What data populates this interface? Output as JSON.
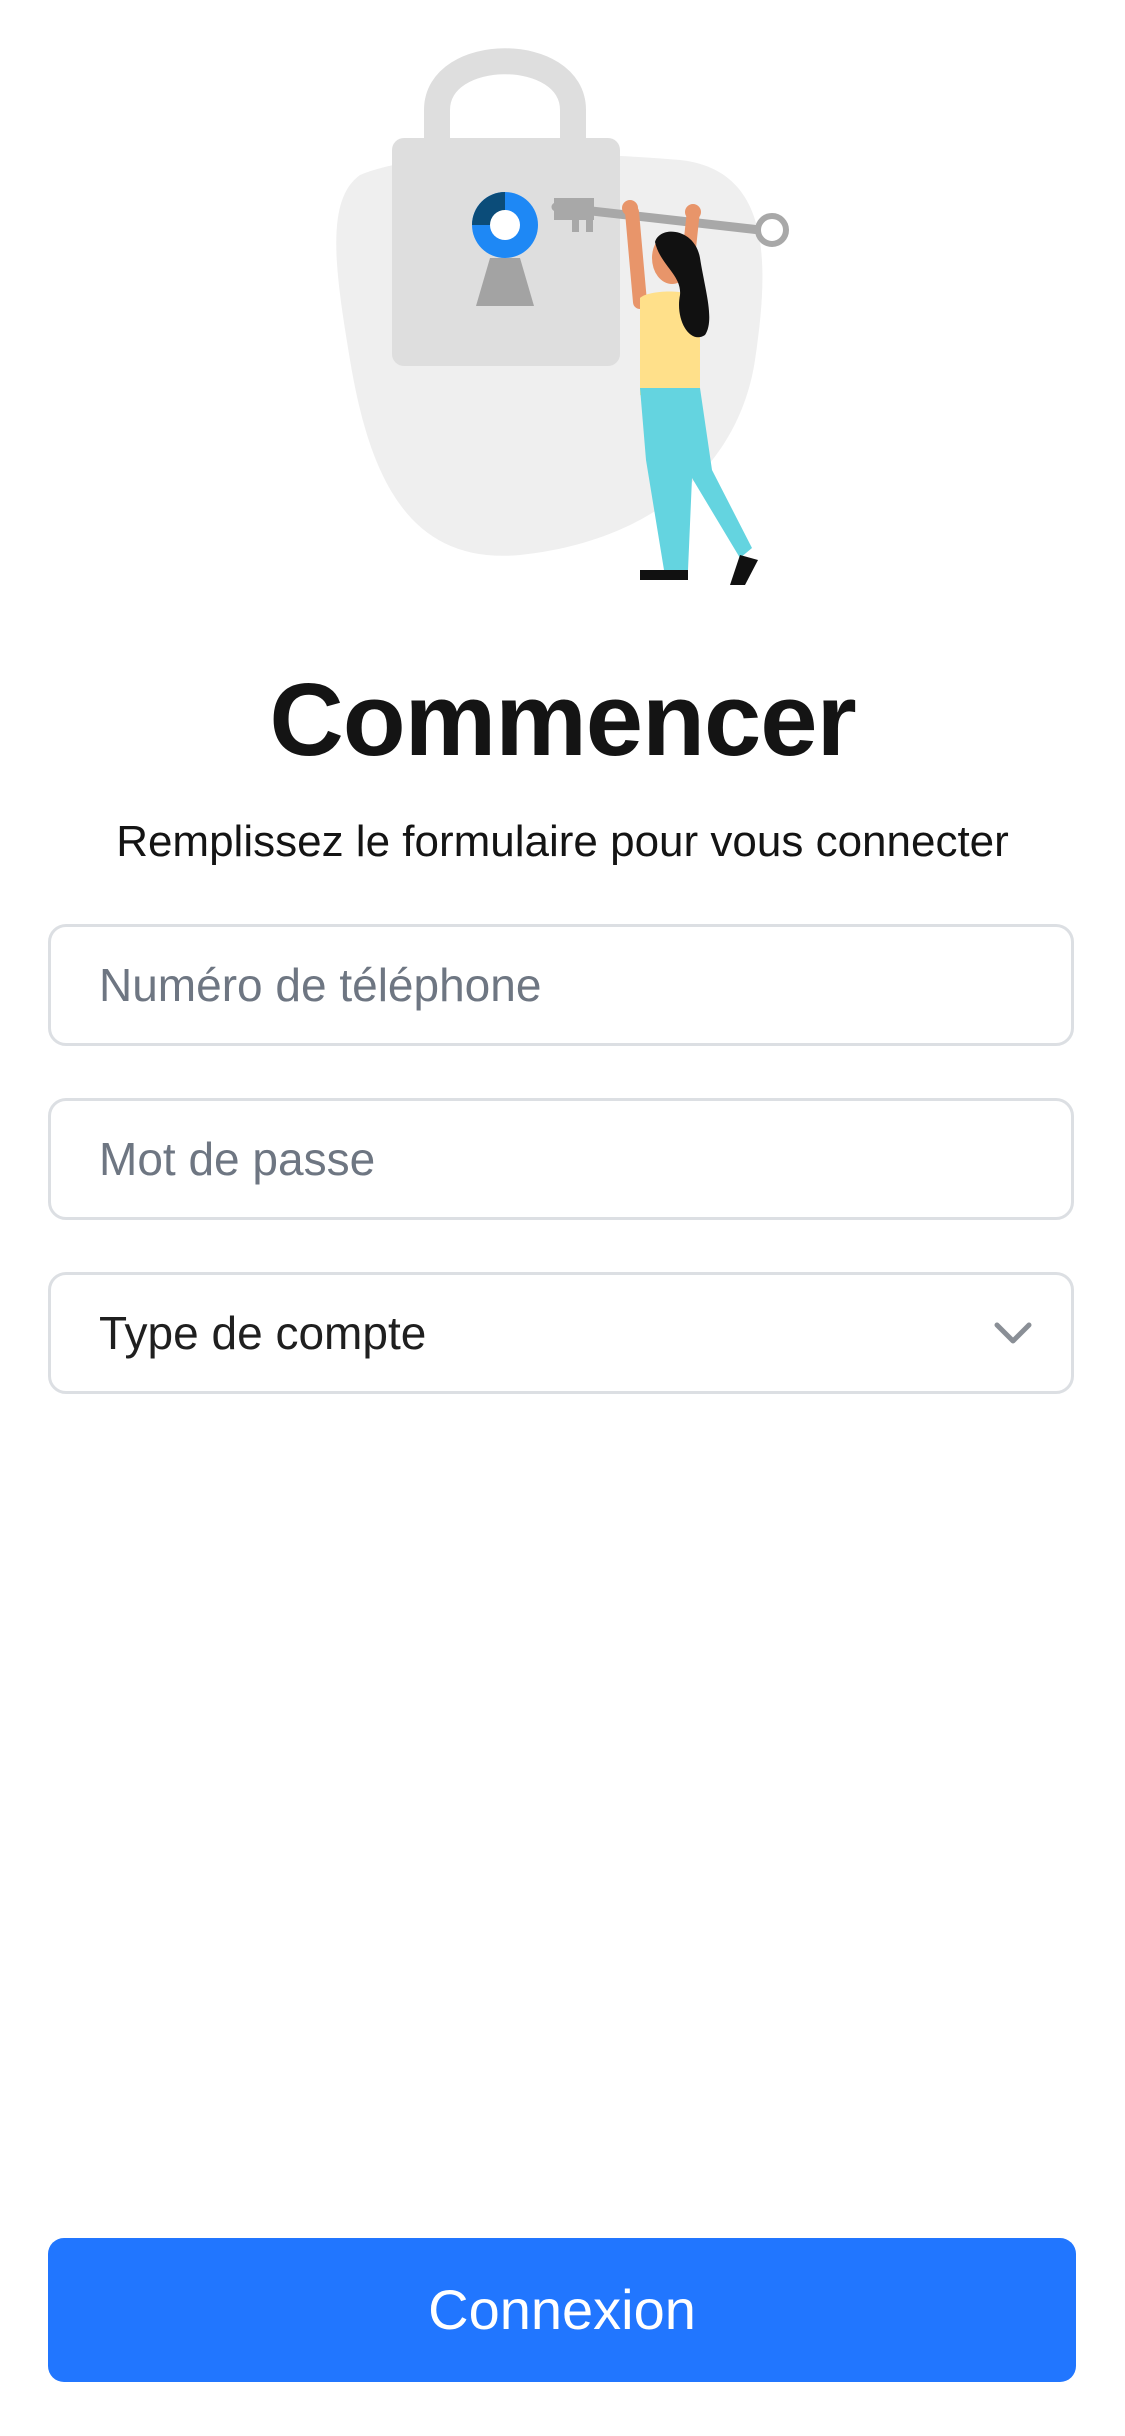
{
  "header": {
    "title": "Commencer",
    "subtitle": "Remplissez le formulaire pour vous connecter"
  },
  "illustration": {
    "icon": "lock-key-illustration"
  },
  "form": {
    "phone": {
      "placeholder": "Numéro de téléphone",
      "value": ""
    },
    "password": {
      "placeholder": "Mot de passe",
      "value": ""
    },
    "account_type": {
      "selected": "Type de compte",
      "icon": "chevron-down-icon"
    }
  },
  "actions": {
    "login_label": "Connexion"
  },
  "colors": {
    "primary": "#2176ff",
    "text": "#141414",
    "placeholder": "#6e7682",
    "border": "#dcdfe3",
    "keyhole_blue": "#1e88f5",
    "keyhole_dark": "#0b4c79"
  }
}
